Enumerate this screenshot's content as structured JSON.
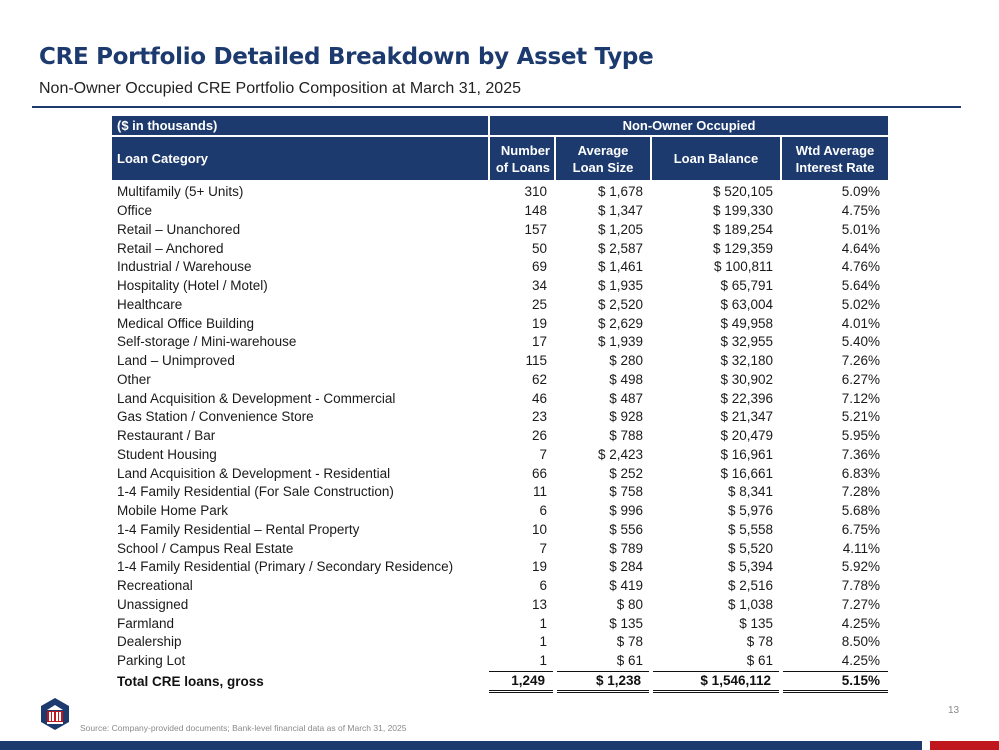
{
  "header": {
    "title": "CRE Portfolio Detailed Breakdown by Asset Type",
    "subtitle": "Non-Owner Occupied CRE Portfolio Composition at March 31, 2025"
  },
  "table": {
    "units_label": "($ in thousands)",
    "group_label": "Non-Owner Occupied",
    "columns": {
      "category": "Loan Category",
      "num_loans": [
        "Number",
        "of Loans"
      ],
      "avg_size": [
        "Average",
        "Loan Size"
      ],
      "balance": "Loan Balance",
      "rate": [
        "Wtd Average",
        "Interest Rate"
      ]
    },
    "rows": [
      {
        "category": "Multifamily (5+ Units)",
        "num": "310",
        "avg": "$ 1,678",
        "bal": "$ 520,105",
        "rate": "5.09%"
      },
      {
        "category": "Office",
        "num": "148",
        "avg": "$ 1,347",
        "bal": "$ 199,330",
        "rate": "4.75%"
      },
      {
        "category": "Retail – Unanchored",
        "num": "157",
        "avg": "$ 1,205",
        "bal": "$ 189,254",
        "rate": "5.01%"
      },
      {
        "category": "Retail – Anchored",
        "num": "50",
        "avg": "$ 2,587",
        "bal": "$ 129,359",
        "rate": "4.64%"
      },
      {
        "category": "Industrial / Warehouse",
        "num": "69",
        "avg": "$ 1,461",
        "bal": "$ 100,811",
        "rate": "4.76%"
      },
      {
        "category": "Hospitality (Hotel / Motel)",
        "num": "34",
        "avg": "$ 1,935",
        "bal": "$ 65,791",
        "rate": "5.64%"
      },
      {
        "category": "Healthcare",
        "num": "25",
        "avg": "$ 2,520",
        "bal": "$ 63,004",
        "rate": "5.02%"
      },
      {
        "category": "Medical Office Building",
        "num": "19",
        "avg": "$ 2,629",
        "bal": "$ 49,958",
        "rate": "4.01%"
      },
      {
        "category": "Self-storage / Mini-warehouse",
        "num": "17",
        "avg": "$ 1,939",
        "bal": "$ 32,955",
        "rate": "5.40%"
      },
      {
        "category": "Land – Unimproved",
        "num": "115",
        "avg": "$ 280",
        "bal": "$ 32,180",
        "rate": "7.26%"
      },
      {
        "category": "Other",
        "num": "62",
        "avg": "$ 498",
        "bal": "$ 30,902",
        "rate": "6.27%"
      },
      {
        "category": "Land Acquisition & Development - Commercial",
        "num": "46",
        "avg": "$ 487",
        "bal": "$ 22,396",
        "rate": "7.12%"
      },
      {
        "category": "Gas Station / Convenience Store",
        "num": "23",
        "avg": "$ 928",
        "bal": "$ 21,347",
        "rate": "5.21%"
      },
      {
        "category": "Restaurant / Bar",
        "num": "26",
        "avg": "$ 788",
        "bal": "$ 20,479",
        "rate": "5.95%"
      },
      {
        "category": "Student Housing",
        "num": "7",
        "avg": "$ 2,423",
        "bal": "$ 16,961",
        "rate": "7.36%"
      },
      {
        "category": "Land Acquisition & Development - Residential",
        "num": "66",
        "avg": "$ 252",
        "bal": "$ 16,661",
        "rate": "6.83%"
      },
      {
        "category": "1-4 Family Residential (For Sale Construction)",
        "num": "11",
        "avg": "$ 758",
        "bal": "$ 8,341",
        "rate": "7.28%"
      },
      {
        "category": "Mobile Home Park",
        "num": "6",
        "avg": "$ 996",
        "bal": "$ 5,976",
        "rate": "5.68%"
      },
      {
        "category": "1-4 Family Residential – Rental Property",
        "num": "10",
        "avg": "$ 556",
        "bal": "$ 5,558",
        "rate": "6.75%"
      },
      {
        "category": "School / Campus Real Estate",
        "num": "7",
        "avg": "$ 789",
        "bal": "$ 5,520",
        "rate": "4.11%"
      },
      {
        "category": "1-4 Family Residential (Primary / Secondary Residence)",
        "num": "19",
        "avg": "$ 284",
        "bal": "$ 5,394",
        "rate": "5.92%"
      },
      {
        "category": "Recreational",
        "num": "6",
        "avg": "$ 419",
        "bal": "$ 2,516",
        "rate": "7.78%"
      },
      {
        "category": "Unassigned",
        "num": "13",
        "avg": "$ 80",
        "bal": "$ 1,038",
        "rate": "7.27%"
      },
      {
        "category": "Farmland",
        "num": "1",
        "avg": "$ 135",
        "bal": "$ 135",
        "rate": "4.25%"
      },
      {
        "category": "Dealership",
        "num": "1",
        "avg": "$ 78",
        "bal": "$ 78",
        "rate": "8.50%"
      },
      {
        "category": "Parking Lot",
        "num": "1",
        "avg": "$ 61",
        "bal": "$ 61",
        "rate": "4.25%"
      }
    ],
    "total": {
      "category": "Total CRE loans, gross",
      "num": "1,249",
      "avg": "$ 1,238",
      "bal": "$ 1,546,112",
      "rate": "5.15%"
    }
  },
  "footer": {
    "source": "Source: Company-provided documents; Bank-level financial data as of March 31, 2025",
    "page_number": "13",
    "logo_icon": "bank-logo-icon",
    "colors": {
      "navy": "#1c3a6e",
      "red": "#c0161d"
    }
  }
}
